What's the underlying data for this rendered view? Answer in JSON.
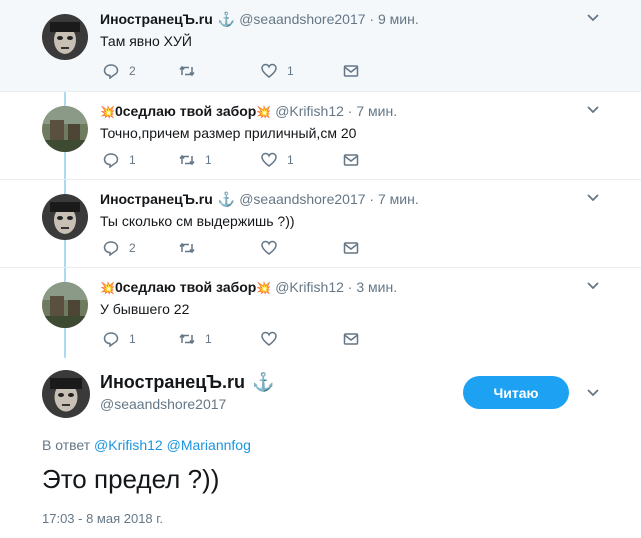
{
  "tweets": [
    {
      "name": "ИностранецЪ.ru",
      "name_suffix": "⚓",
      "handle": "@seaandshore2017",
      "separator": "·",
      "time": "9 мин.",
      "text": "Там явно ХУЙ",
      "replies": "2",
      "retweets": "",
      "likes": "1",
      "avatar": "pirate-face-avatar"
    },
    {
      "name_prefix": "💥",
      "name": "0седлаю твой забор",
      "name_suffix": "💥",
      "handle": "@Krifish12",
      "separator": "·",
      "time": "7 мин.",
      "text": "Точно,причем размер приличный,см 20",
      "replies": "1",
      "retweets": "1",
      "likes": "1",
      "avatar": "forest-ruins-avatar"
    },
    {
      "name": "ИностранецЪ.ru",
      "name_suffix": "⚓",
      "handle": "@seaandshore2017",
      "separator": "·",
      "time": "7 мин.",
      "text": "Ты сколько см выдержишь ?))",
      "replies": "2",
      "retweets": "",
      "likes": "",
      "avatar": "pirate-face-avatar"
    },
    {
      "name_prefix": "💥",
      "name": "0седлаю твой забор",
      "name_suffix": "💥",
      "handle": "@Krifish12",
      "separator": "·",
      "time": "3 мин.",
      "text": "У бывшего 22",
      "replies": "1",
      "retweets": "1",
      "likes": "",
      "avatar": "forest-ruins-avatar"
    }
  ],
  "main": {
    "name": "ИностранецЪ.ru",
    "name_suffix": "⚓",
    "handle": "@seaandshore2017",
    "follow_label": "Читаю",
    "reply_prefix": "В ответ",
    "mentions": [
      "@Krifish12",
      "@Mariannfog"
    ],
    "text": "Это предел ?))",
    "timestamp": "17:03 - 8 мая 2018 г."
  },
  "colors": {
    "accent": "#1da1f2",
    "link": "#1b95e0",
    "muted": "#657786",
    "thread_line": "#aadbf3",
    "highlight_bg": "#f5f8fa"
  },
  "icons": [
    "reply-icon",
    "retweet-icon",
    "like-icon",
    "direct-message-icon",
    "chevron-down-icon",
    "anchor-icon",
    "explosion-icon"
  ]
}
